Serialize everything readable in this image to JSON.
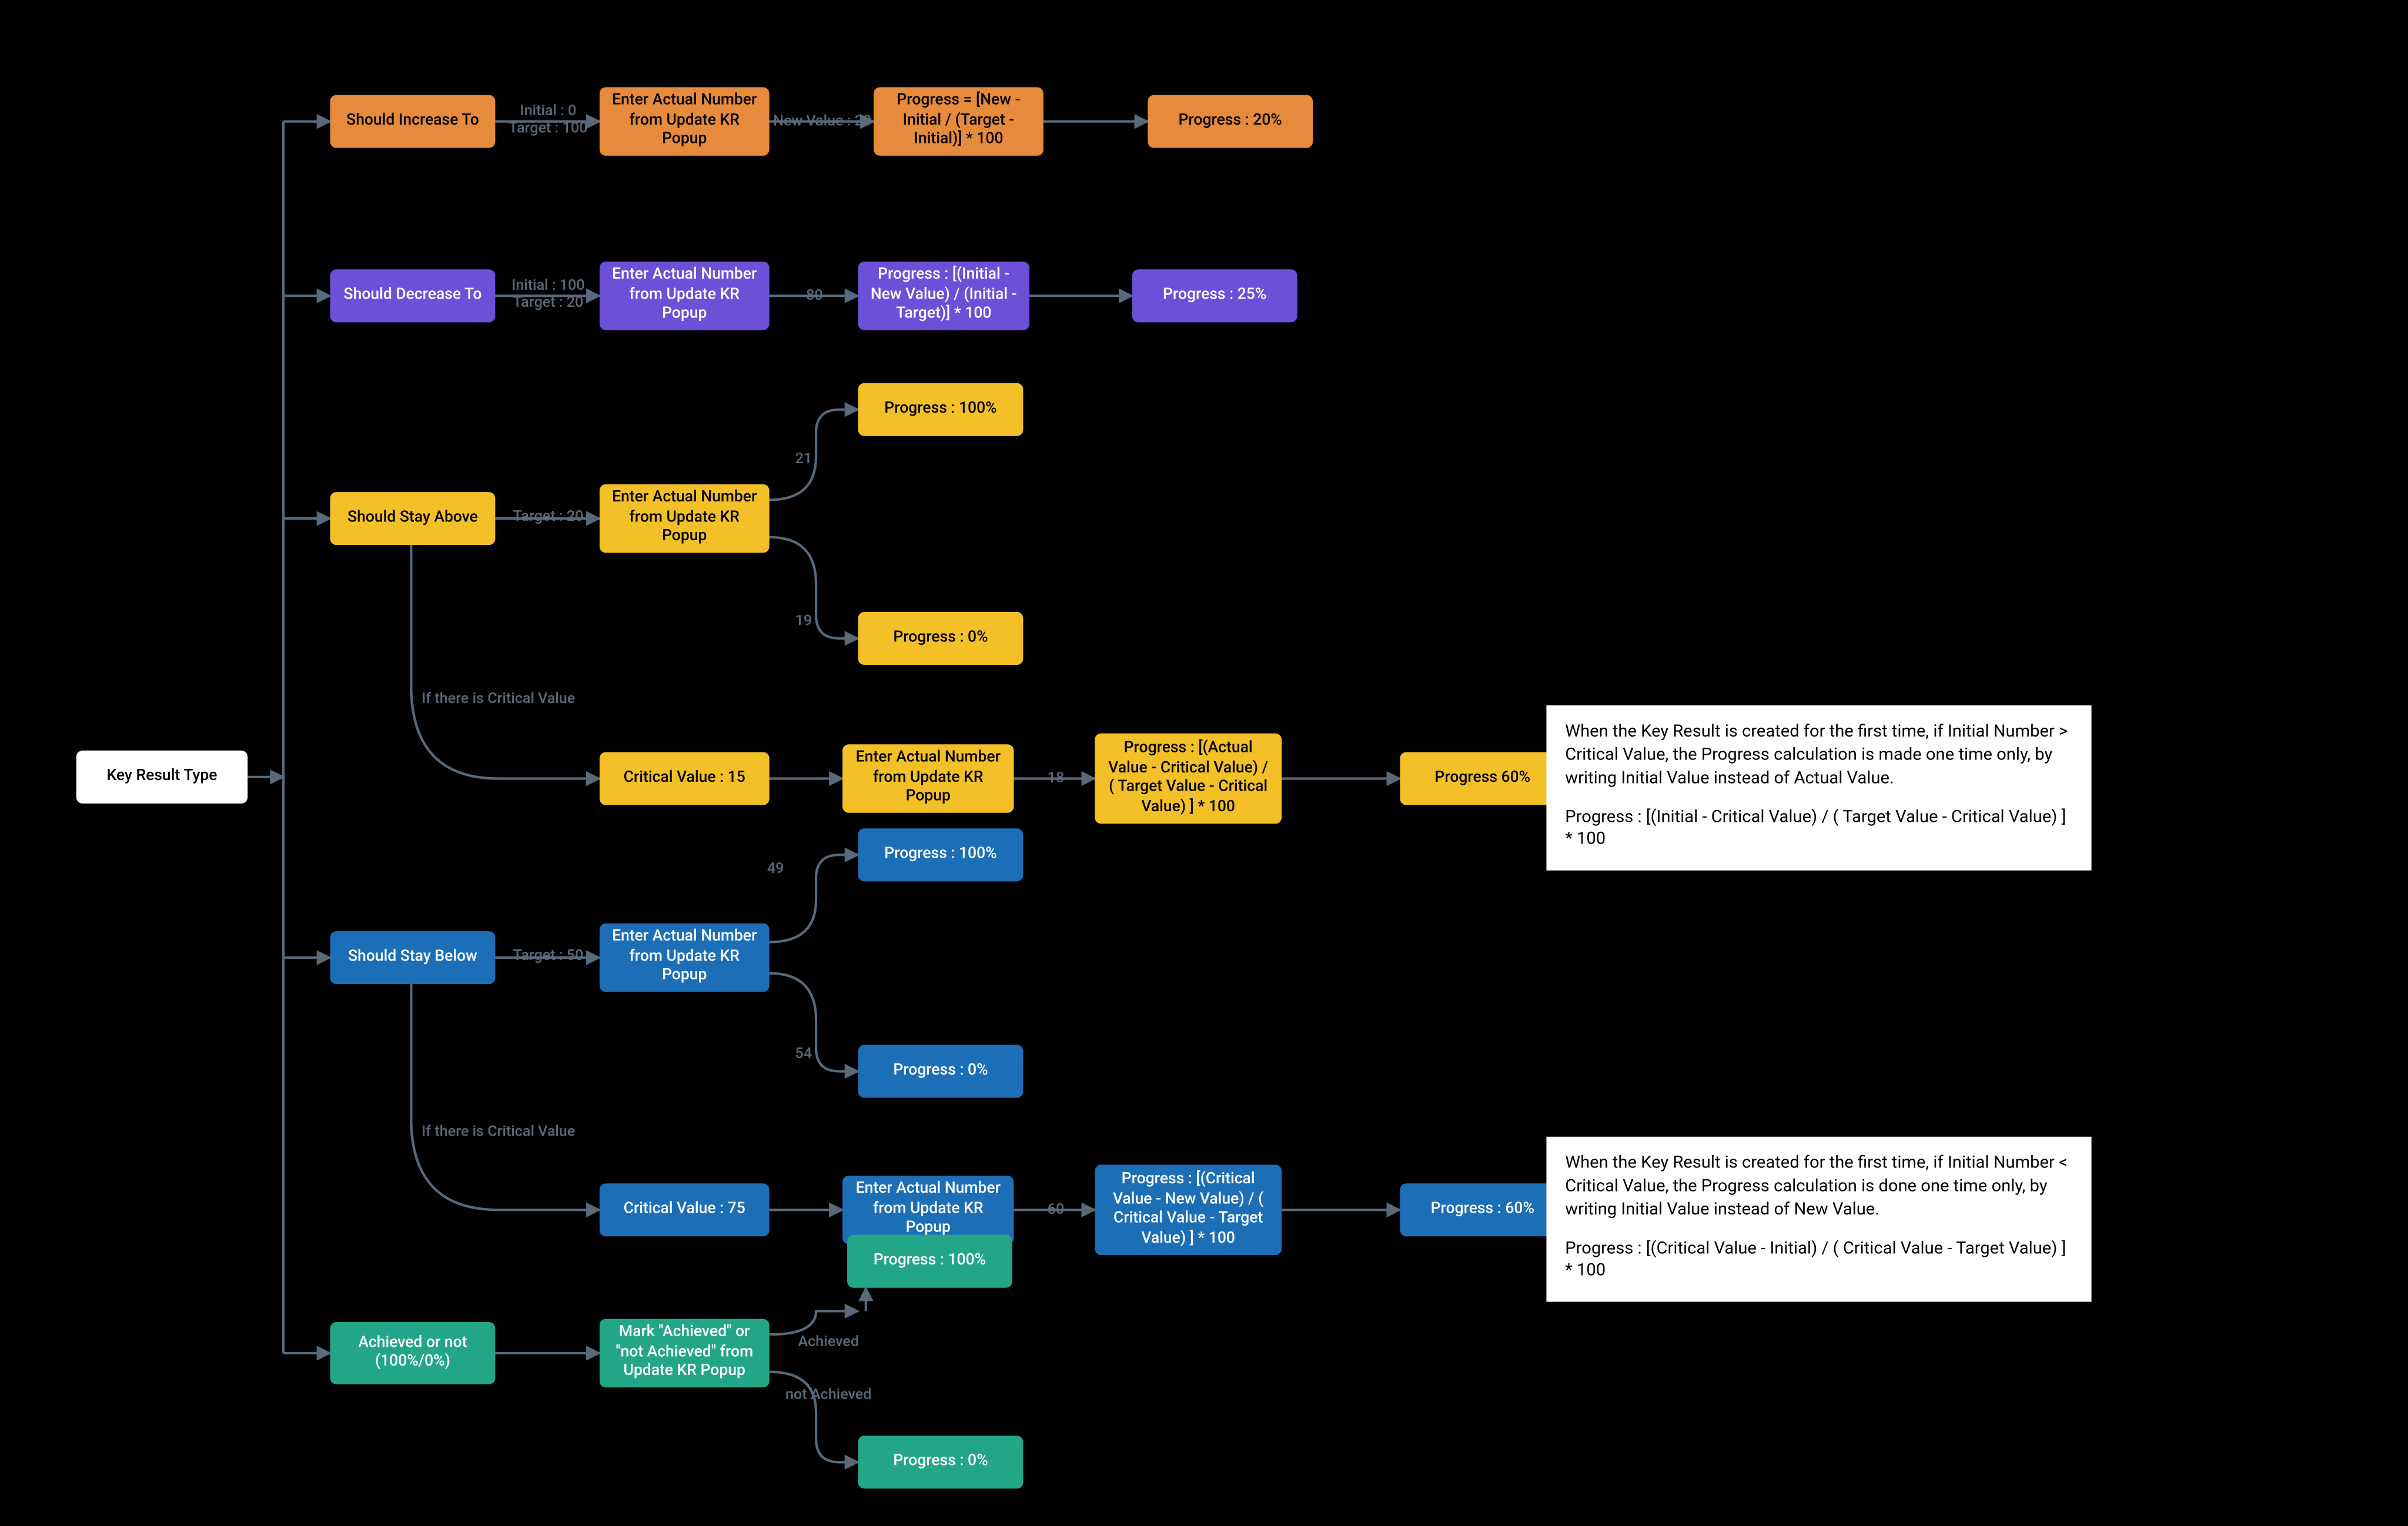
{
  "root": {
    "label": "Key Result Type"
  },
  "increase": {
    "type_label": "Should Increase To",
    "params": "Initial : 0\nTarget : 100",
    "action": "Enter Actual Number from Update KR Popup",
    "new_value": "New Value : 20",
    "formula": "Progress = [New - Initial / (Target - Initial)] * 100",
    "result": "Progress : 20%"
  },
  "decrease": {
    "type_label": "Should Decrease To",
    "params": "Initial : 100\nTarget : 20",
    "action": "Enter Actual Number from Update KR Popup",
    "new_value": "80",
    "formula": "Progress : [(Initial - New Value) / (Initial - Target)] * 100",
    "result": "Progress : 25%"
  },
  "stay_above": {
    "type_label": "Should Stay Above",
    "params": "Target : 20",
    "action": "Enter Actual Number from Update KR Popup",
    "hi_label": "21",
    "hi_result": "Progress : 100%",
    "lo_label": "19",
    "lo_result": "Progress : 0%",
    "crit_branch_label": "If there is Critical Value",
    "crit_value": "Critical Value : 15",
    "crit_action": "Enter Actual Number from Update KR Popup",
    "crit_new_value": "18",
    "crit_formula": "Progress : [(Actual Value - Critical Value) / ( Target  Value - Critical Value) ] * 100",
    "crit_result": "Progress 60%",
    "note_line1": "When the Key Result is created for the first time, if Initial Number > Critical Value, the Progress calculation is made one time only, by writing Initial Value instead of Actual Value.",
    "note_line2": "Progress : [(Initial  - Critical Value) / ( Target  Value - Critical Value) ] * 100"
  },
  "stay_below": {
    "type_label": "Should Stay Below",
    "params": "Target : 50",
    "action": "Enter Actual Number from Update KR Popup",
    "hi_label": "49",
    "hi_result": "Progress : 100%",
    "lo_label": "54",
    "lo_result": "Progress : 0%",
    "crit_branch_label": "If there is Critical Value",
    "crit_value": "Critical Value : 75",
    "crit_action": "Enter Actual Number from Update KR Popup",
    "crit_new_value": "60",
    "crit_formula": "Progress : [(Critical Value - New Value) / ( Critical Value - Target Value) ] * 100",
    "crit_result": "Progress : 60%",
    "note_line1": "When the Key Result is created for the first time, if Initial Number < Critical Value, the Progress calculation is done one time only, by writing Initial Value instead of New Value.",
    "note_line2": "Progress : [(Critical Value - Initial) / ( Critical Value - Target Value) ] * 100"
  },
  "achieved": {
    "type_label": "Achieved or not (100%/0%)",
    "action": "Mark \"Achieved\" or \"not Achieved\" from Update KR Popup",
    "yes_label": "Achieved",
    "yes_result": "Progress : 100%",
    "no_label": "not Achieved",
    "no_result": "Progress : 0%"
  },
  "colors": {
    "edge": "#586a7a",
    "orange": "#e68a3c",
    "purple": "#6c50d8",
    "yellow": "#f4c028",
    "blue": "#1c6fb6",
    "teal": "#23a688"
  }
}
